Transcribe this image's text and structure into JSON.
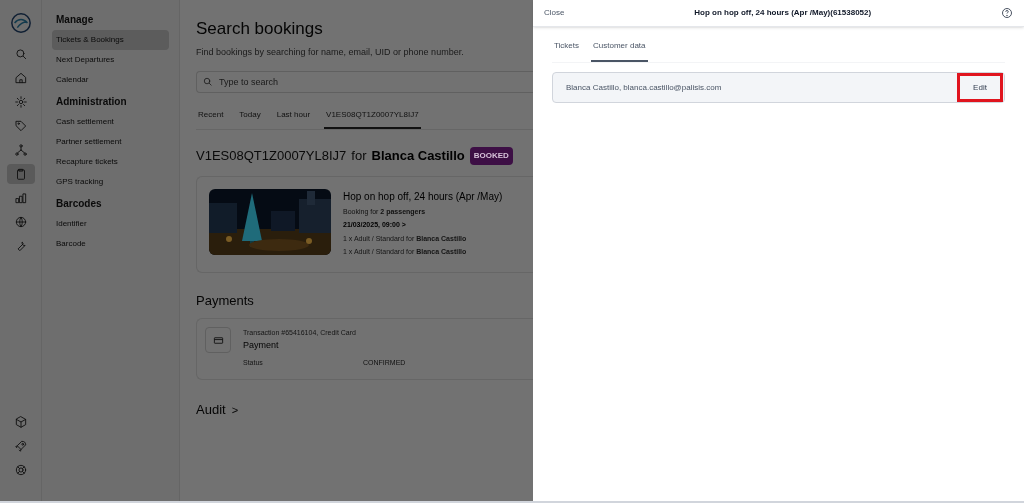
{
  "rail": {
    "items": [
      {
        "selected": false
      },
      {
        "selected": false
      },
      {
        "selected": false
      },
      {
        "selected": false
      },
      {
        "selected": false
      },
      {
        "selected": true
      },
      {
        "selected": false
      },
      {
        "selected": false
      },
      {
        "selected": false
      }
    ]
  },
  "nav": {
    "sections": [
      {
        "title": "Manage",
        "items": [
          {
            "label": "Tickets & Bookings",
            "selected": true
          },
          {
            "label": "Next Departures",
            "selected": false
          },
          {
            "label": "Calendar",
            "selected": false
          }
        ]
      },
      {
        "title": "Administration",
        "items": [
          {
            "label": "Cash settlement",
            "selected": false
          },
          {
            "label": "Partner settlement",
            "selected": false
          },
          {
            "label": "Recapture tickets",
            "selected": false
          },
          {
            "label": "GPS tracking",
            "selected": false
          }
        ]
      },
      {
        "title": "Barcodes",
        "items": [
          {
            "label": "Identifier",
            "selected": false
          },
          {
            "label": "Barcode",
            "selected": false
          }
        ]
      }
    ]
  },
  "main": {
    "title": "Search bookings",
    "subtitle": "Find bookings by searching for name, email, UID or phone number.",
    "search": {
      "placeholder": "Type to search"
    },
    "tabs": [
      {
        "label": "Recent",
        "selected": false
      },
      {
        "label": "Today",
        "selected": false
      },
      {
        "label": "Last hour",
        "selected": false
      },
      {
        "label": "V1ES08QT1Z0007YL8IJ7",
        "selected": true
      }
    ],
    "booking": {
      "code": "V1ES08QT1Z0007YL8IJ7",
      "for": "for",
      "customer": "Blanca Castillo",
      "status": "BOOKED",
      "product": {
        "title": "Hop on hop off,  24 hours (Apr /May)",
        "passengers": "Booking for **2 passengers**",
        "date": "21/03/2025, 09:00 >",
        "lines": [
          "1 x Adult / Standard for **Blanca Castillo**",
          "1 x Adult / Standard for **Blanca Castillo**"
        ]
      }
    },
    "payments": {
      "title": "Payments",
      "transaction": "Transaction #65416104, Credit Card",
      "name": "Payment",
      "status_label": "Status",
      "status_value": "CONFIRMED"
    },
    "audit": {
      "title": "Audit",
      "chevron": ">"
    }
  },
  "drawer": {
    "close": "Close",
    "title": "Hop on hop off,  24 hours (Apr /May)(61538052)",
    "tabs": [
      {
        "label": "Tickets",
        "selected": false
      },
      {
        "label": "Customer data",
        "selected": true
      }
    ],
    "customer": {
      "text": "Blanca Castillo,  blanca.castillo@palisis.com",
      "edit": {
        "label": "Edit",
        "highlighted": true
      }
    }
  }
}
